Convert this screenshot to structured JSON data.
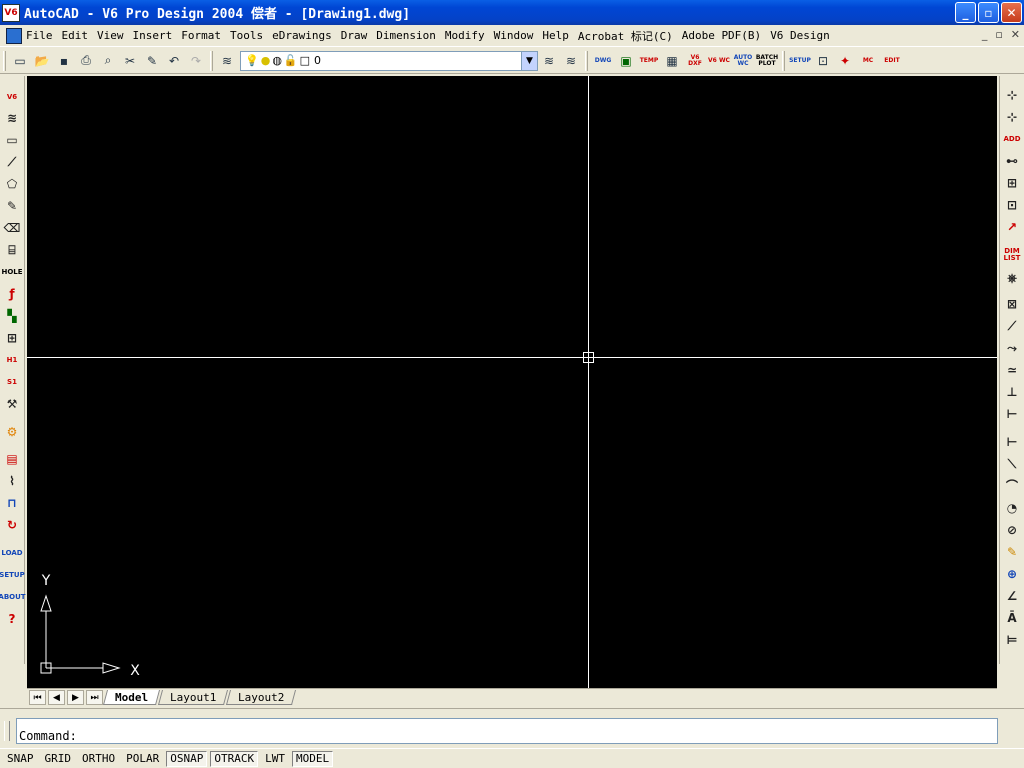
{
  "window": {
    "title": "AutoCAD - V6 Pro Design 2004 偿者 - [Drawing1.dwg]",
    "logo": "V6",
    "buttons": {
      "minimize": "_",
      "restore": "▫",
      "close": "✕"
    }
  },
  "menu": {
    "items": [
      "File",
      "Edit",
      "View",
      "Insert",
      "Format",
      "Tools",
      "eDrawings",
      "Draw",
      "Dimension",
      "Modify",
      "Window",
      "Help",
      "Acrobat 标记(C)",
      "Adobe PDF(B)",
      "V6 Design"
    ],
    "doc_controls": [
      "_",
      "▫",
      "✕"
    ]
  },
  "toolbar": {
    "layer_value": "0",
    "right_labels": [
      "DWG",
      "",
      "TEMP",
      "",
      "V6 DXF",
      "V6 WC",
      "AUTO WC",
      "BATCH PLOT",
      "SETUP",
      "",
      "",
      "MC",
      "EDIT"
    ]
  },
  "left_toolbar": {
    "labels": [
      "V6",
      "",
      "",
      "",
      "",
      "",
      "",
      "",
      "HOLE",
      "",
      "",
      "",
      "H1",
      "S1",
      "",
      "",
      "",
      "",
      "",
      "",
      "LOAD",
      "SETUP",
      "ABOUT",
      "?"
    ]
  },
  "right_toolbar": {
    "labels": [
      "",
      "",
      "ADD",
      "",
      "",
      "",
      "",
      "DIM LIST",
      "",
      "",
      "",
      "",
      "",
      "",
      "",
      "",
      "",
      "",
      "",
      "",
      "",
      "",
      "",
      "",
      "",
      ""
    ]
  },
  "canvas": {
    "ucs_y": "Y",
    "ucs_x": "X"
  },
  "tabs": {
    "items": [
      "Model",
      "Layout1",
      "Layout2"
    ],
    "active": "Model"
  },
  "command": {
    "prompt": "Command:"
  },
  "status": {
    "buttons": [
      "SNAP",
      "GRID",
      "ORTHO",
      "POLAR",
      "OSNAP",
      "OTRACK",
      "LWT",
      "MODEL"
    ],
    "on": [
      "OSNAP",
      "OTRACK",
      "MODEL"
    ]
  }
}
